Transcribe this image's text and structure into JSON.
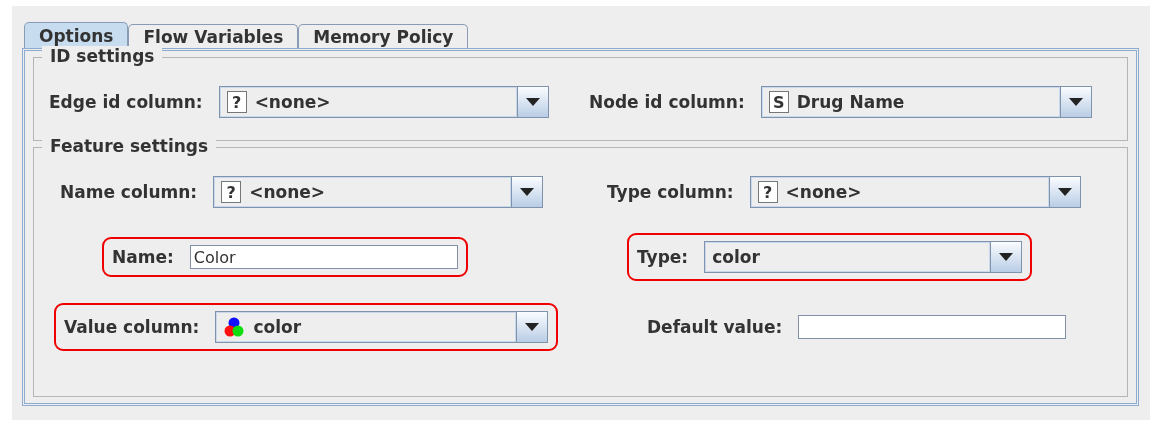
{
  "tabs": [
    {
      "label": "Options",
      "selected": true
    },
    {
      "label": "Flow Variables",
      "selected": false
    },
    {
      "label": "Memory Policy",
      "selected": false
    }
  ],
  "sections": [
    {
      "title": "ID settings",
      "rows": [
        [
          {
            "kind": "combo",
            "label": "Edge id column:",
            "icon": {
              "kind": "letter",
              "text": "?"
            },
            "value": "<none>",
            "highlighted": false
          },
          {
            "kind": "combo",
            "label": "Node id column:",
            "icon": {
              "kind": "letter",
              "text": "S"
            },
            "value": "Drug Name",
            "highlighted": false
          }
        ]
      ]
    },
    {
      "title": "Feature settings",
      "rows": [
        [
          {
            "kind": "combo",
            "label": "Name column:",
            "icon": {
              "kind": "letter",
              "text": "?"
            },
            "value": "<none>",
            "highlighted": false
          },
          {
            "kind": "combo",
            "label": "Type column:",
            "icon": {
              "kind": "letter",
              "text": "?"
            },
            "value": "<none>",
            "highlighted": false
          }
        ],
        [
          {
            "kind": "text",
            "label": "Name:",
            "value": "Color",
            "highlighted": true
          },
          {
            "kind": "combo",
            "label": "Type:",
            "value": "color",
            "highlighted": true
          }
        ],
        [
          {
            "kind": "combo",
            "label": "Value column:",
            "icon": {
              "kind": "color"
            },
            "value": "color",
            "highlighted": true
          },
          {
            "kind": "text",
            "label": "Default value:",
            "highlighted": false
          }
        ]
      ]
    }
  ]
}
